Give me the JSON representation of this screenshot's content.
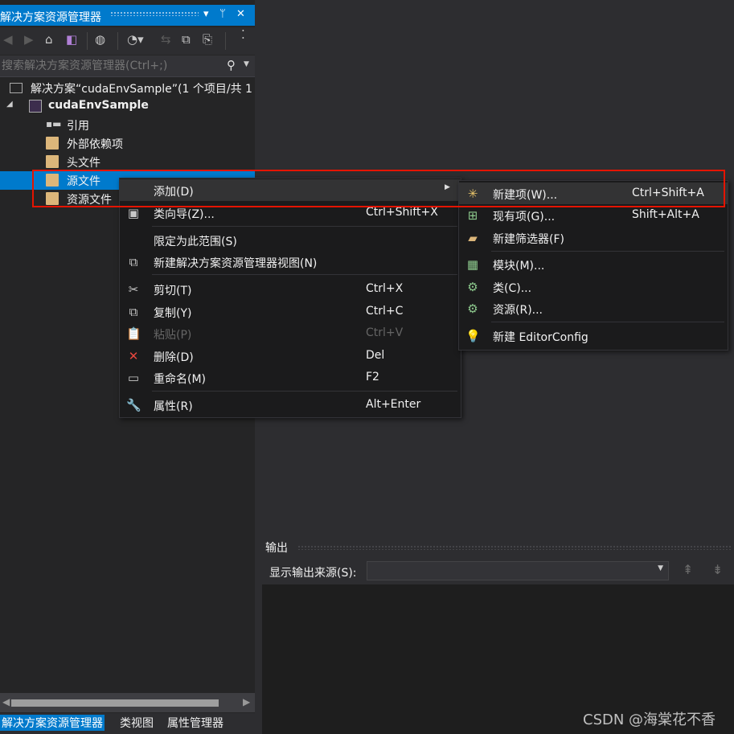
{
  "solution_explorer": {
    "title": "解决方案资源管理器",
    "title_pin": "▾ ᛘ ✕",
    "search_placeholder": "搜索解决方案资源管理器(Ctrl+;)",
    "tree": {
      "solution": "解决方案“cudaEnvSample”(1 个项目/共 1",
      "project": "cudaEnvSample",
      "items": [
        "引用",
        "外部依赖项",
        "头文件",
        "源文件",
        "资源文件"
      ]
    },
    "bottom_tabs": [
      "解决方案资源管理器",
      "类视图",
      "属性管理器"
    ]
  },
  "context_menu": {
    "items": [
      {
        "label": "添加(D)",
        "shortcut": "",
        "icon": "none",
        "has_submenu": true
      },
      {
        "label": "类向导(Z)...",
        "shortcut": "Ctrl+Shift+X",
        "icon": "class-wizard-icon"
      },
      {
        "label": "限定为此范围(S)",
        "shortcut": "",
        "icon": "none"
      },
      {
        "label": "新建解决方案资源管理器视图(N)",
        "shortcut": "",
        "icon": "new-view-icon"
      },
      {
        "label": "剪切(T)",
        "shortcut": "Ctrl+X",
        "icon": "scissors-icon"
      },
      {
        "label": "复制(Y)",
        "shortcut": "Ctrl+C",
        "icon": "copy-icon"
      },
      {
        "label": "粘贴(P)",
        "shortcut": "Ctrl+V",
        "icon": "paste-icon",
        "disabled": true
      },
      {
        "label": "删除(D)",
        "shortcut": "Del",
        "icon": "delete-icon"
      },
      {
        "label": "重命名(M)",
        "shortcut": "F2",
        "icon": "rename-icon"
      },
      {
        "label": "属性(R)",
        "shortcut": "Alt+Enter",
        "icon": "wrench-icon"
      }
    ]
  },
  "submenu": {
    "items": [
      {
        "label": "新建项(W)...",
        "shortcut": "Ctrl+Shift+A",
        "icon": "new-item-icon"
      },
      {
        "label": "现有项(G)...",
        "shortcut": "Shift+Alt+A",
        "icon": "existing-item-icon"
      },
      {
        "label": "新建筛选器(F)",
        "shortcut": "",
        "icon": "new-filter-icon"
      },
      {
        "label": "模块(M)...",
        "shortcut": "",
        "icon": "module-icon"
      },
      {
        "label": "类(C)...",
        "shortcut": "",
        "icon": "class-icon"
      },
      {
        "label": "资源(R)...",
        "shortcut": "",
        "icon": "resource-icon"
      },
      {
        "label": "新建 EditorConfig",
        "shortcut": "",
        "icon": "editorconfig-icon"
      }
    ]
  },
  "output": {
    "title": "输出",
    "source_label": "显示输出来源(S):",
    "source_value": ""
  },
  "watermark": "CSDN @海棠花不香",
  "colors": {
    "accent": "#007acc",
    "highlight_box": "#e51400",
    "folder": "#dcb67a"
  }
}
